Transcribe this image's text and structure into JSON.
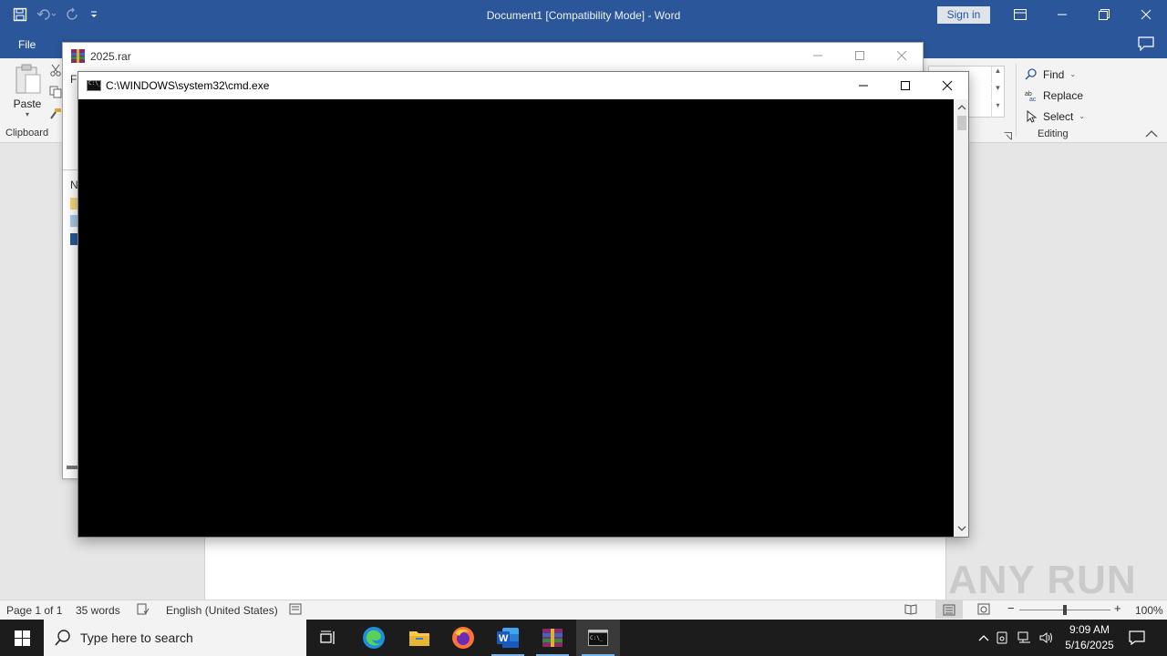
{
  "word": {
    "title": "Document1 [Compatibility Mode]  -  Word",
    "sign_in": "Sign in",
    "file_tab": "File",
    "paste": "Paste",
    "clipboard_label": "Clipboard",
    "editing": {
      "find": "Find",
      "replace": "Replace",
      "select": "Select",
      "label": "Editing"
    },
    "status": {
      "page": "Page 1 of 1",
      "words": "35 words",
      "language": "English (United States)",
      "zoom": "100%"
    }
  },
  "rar": {
    "title": "2025.rar",
    "menu_fragment": "Fi",
    "list_header_fragment": "N"
  },
  "cmd": {
    "title": "C:\\WINDOWS\\system32\\cmd.exe"
  },
  "watermark": "ANY RUN",
  "taskbar": {
    "search_placeholder": "Type here to search",
    "time": "9:09 AM",
    "date": "5/16/2025"
  },
  "colors": {
    "word_blue": "#2b579a",
    "taskbar_bg": "#1c1c1c",
    "console_bg": "#000000"
  }
}
